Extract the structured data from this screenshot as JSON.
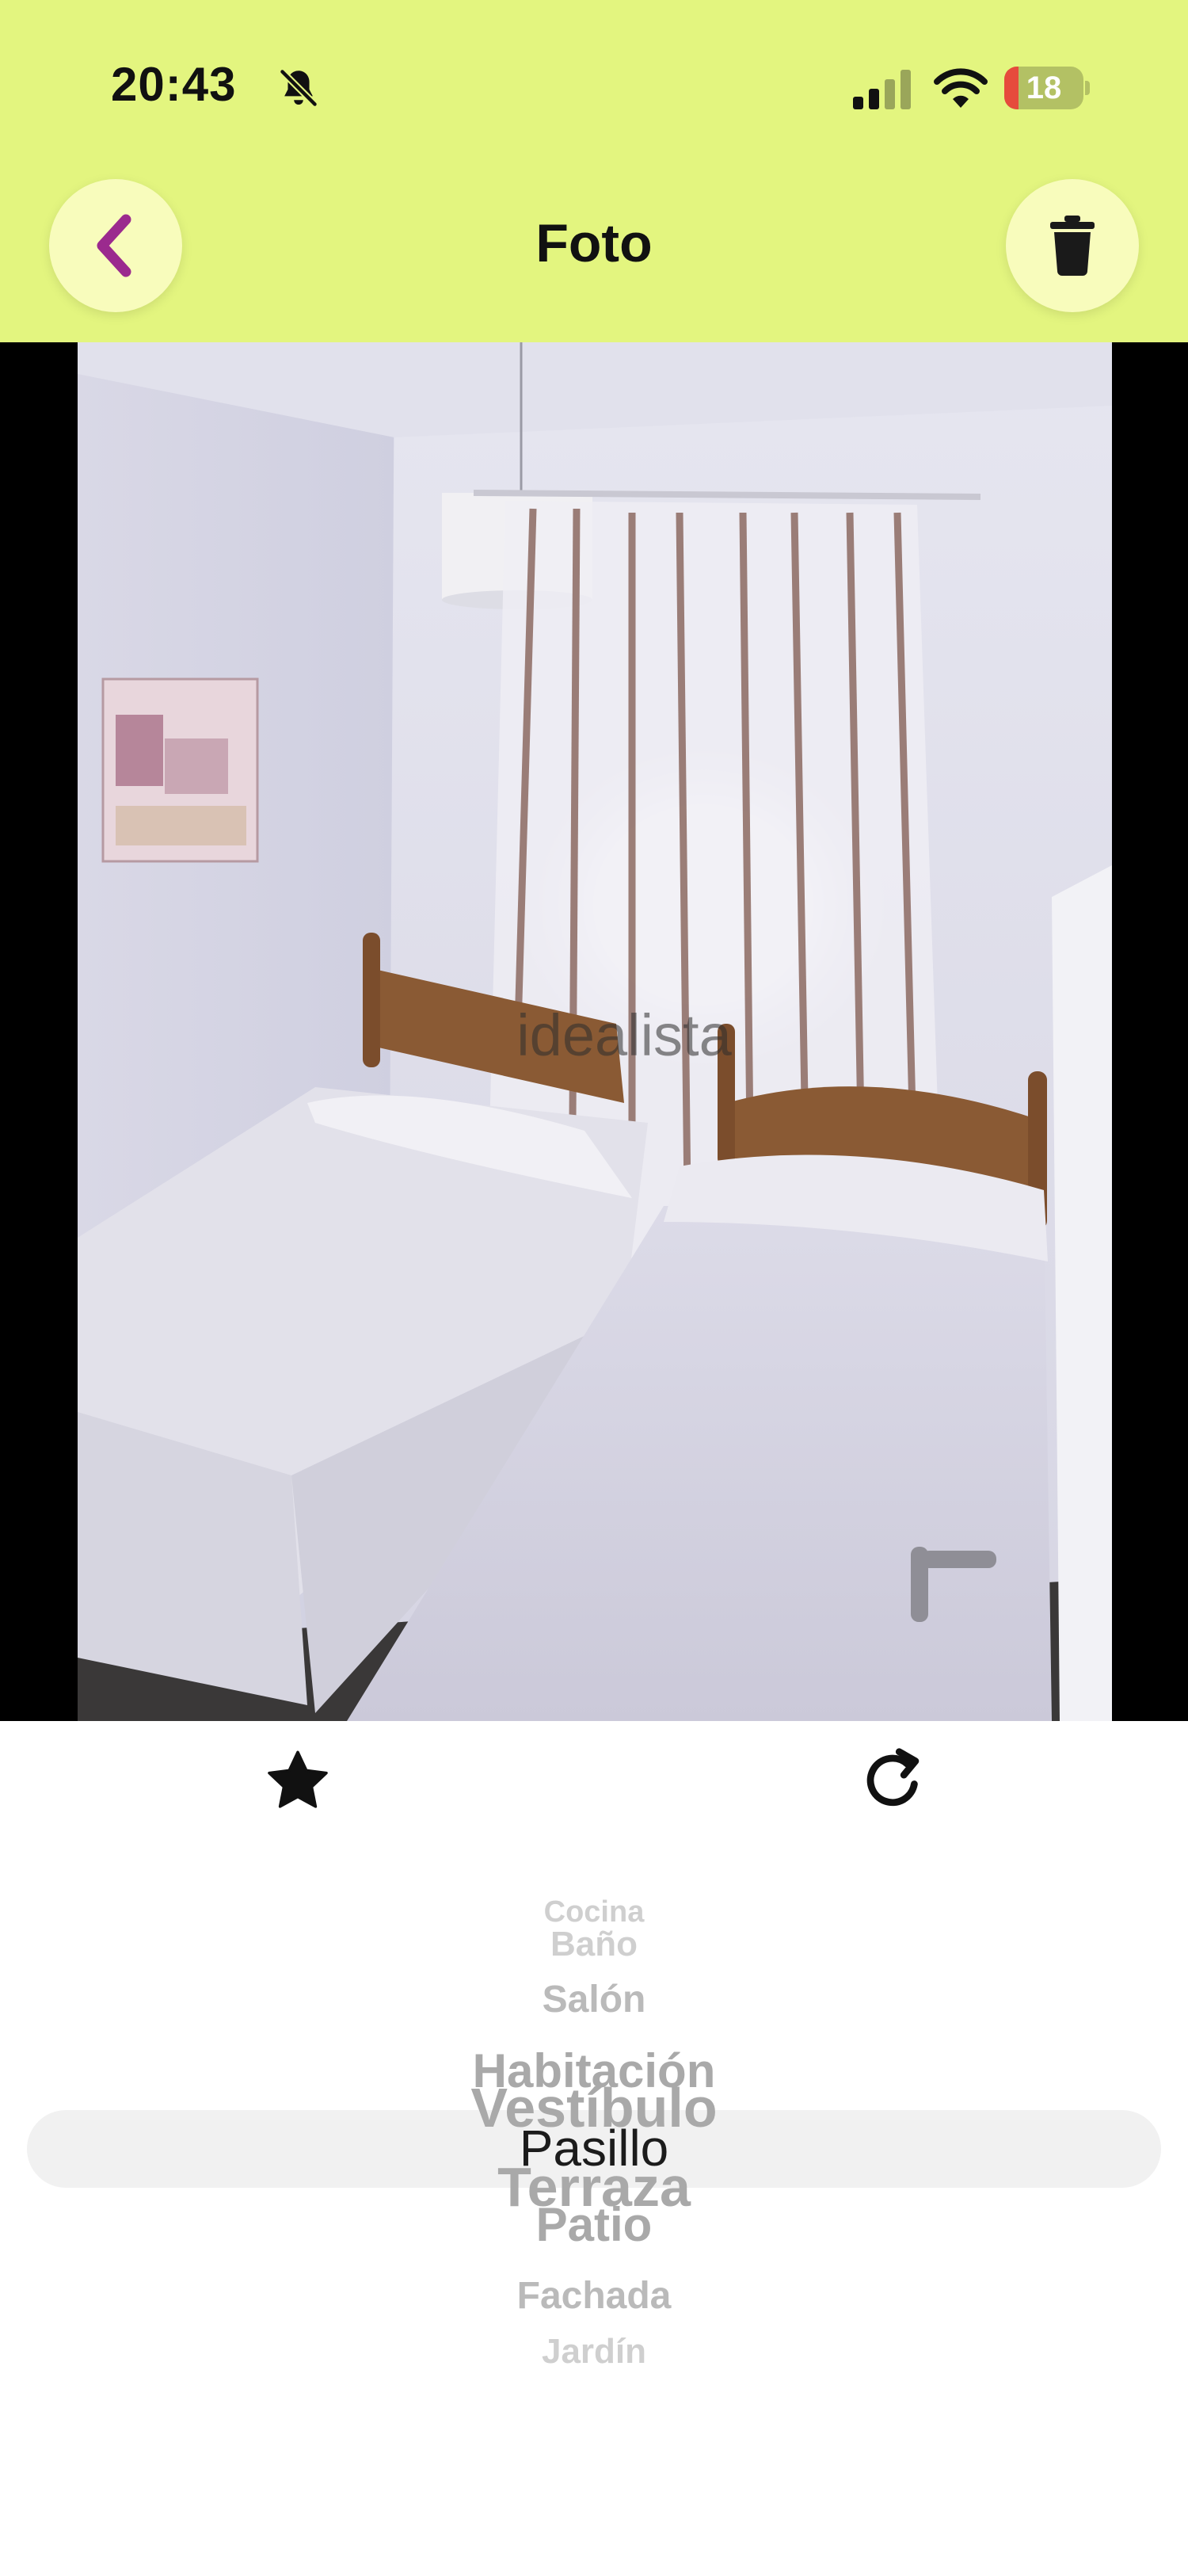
{
  "status_bar": {
    "time": "20:43",
    "battery_level": "18",
    "battery_fraction": 0.18,
    "icons": [
      "bell-slash-icon",
      "cellular-signal-icon",
      "wifi-icon",
      "battery-icon"
    ]
  },
  "header": {
    "title": "Foto",
    "back_icon": "chevron-left-icon",
    "delete_icon": "trash-icon"
  },
  "photo": {
    "watermark": "idealista"
  },
  "actions": {
    "favorite_icon": "star-icon",
    "rotate_icon": "rotate-clockwise-icon"
  },
  "picker": {
    "items": [
      "Cocina",
      "Baño",
      "Salón",
      "Habitación",
      "Vestíbulo",
      "Pasillo",
      "Terraza",
      "Patio",
      "Fachada",
      "Jardín"
    ],
    "selected": "Pasillo"
  },
  "colors": {
    "header_bg": "#e3f57f",
    "button_bg": "#f8fcbc",
    "accent": "#9b2a8e",
    "battery_low": "#e64b3c"
  }
}
